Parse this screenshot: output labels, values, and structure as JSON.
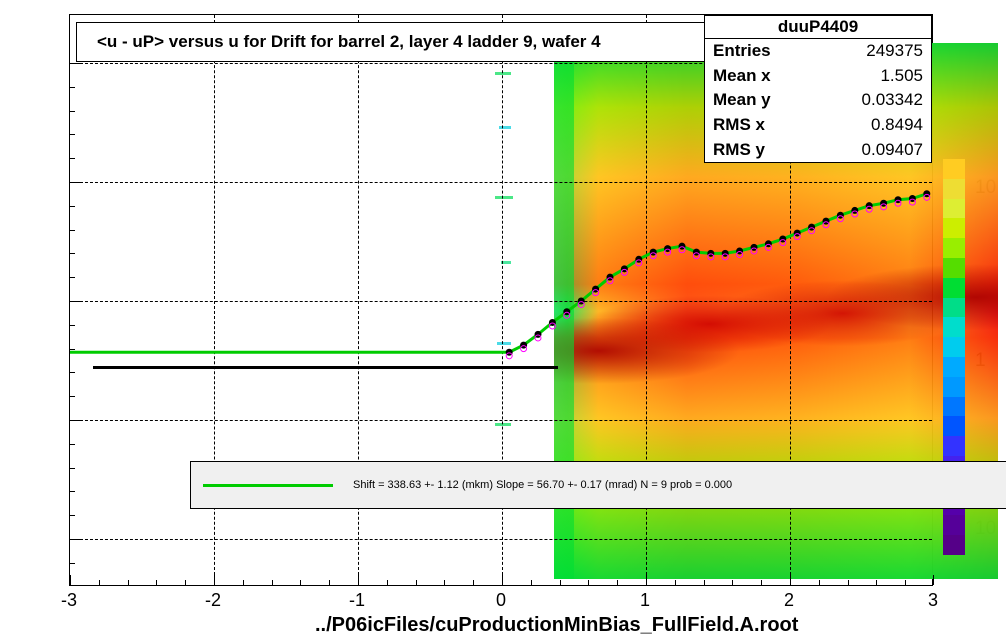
{
  "chart_data": {
    "type": "heatmap",
    "title": "<u - uP>       versus   u for Drift for barrel 2, layer 4 ladder 9, wafer 4",
    "histogram_name": "duuP4409",
    "x_range": [
      -3,
      3
    ],
    "y_range": [
      -0.24,
      0.24
    ],
    "x_ticks": [
      -3,
      -2,
      -1,
      0,
      1,
      2,
      3
    ],
    "y_ticks": [
      -0.2,
      -0.1,
      0,
      0.1,
      0.2
    ],
    "z_scale": "log",
    "z_labels": [
      "10",
      "1",
      "10"
    ],
    "x_caption": "../P06icFiles/cuProductionMinBias_FullField.A.root",
    "stats": {
      "Entries": "249375",
      "Mean x": "1.505",
      "Mean y": "0.03342",
      "RMS x": "0.8494",
      "RMS y": "0.09407"
    },
    "flat_line_y": -0.043,
    "profile_points": {
      "x": [
        0.05,
        0.15,
        0.25,
        0.35,
        0.45,
        0.55,
        0.65,
        0.75,
        0.85,
        0.95,
        1.05,
        1.15,
        1.25,
        1.35,
        1.45,
        1.55,
        1.65,
        1.75,
        1.85,
        1.95,
        2.05,
        2.15,
        2.25,
        2.35,
        2.45,
        2.55,
        2.65,
        2.75,
        2.85,
        2.95
      ],
      "y": [
        -0.043,
        -0.037,
        -0.028,
        -0.018,
        -0.009,
        0.0,
        0.01,
        0.02,
        0.027,
        0.035,
        0.041,
        0.044,
        0.046,
        0.041,
        0.04,
        0.04,
        0.042,
        0.045,
        0.048,
        0.052,
        0.057,
        0.062,
        0.067,
        0.072,
        0.076,
        0.08,
        0.082,
        0.085,
        0.086,
        0.09
      ]
    },
    "legend": {
      "shift": "338.63 +- 1.12 (mkm)",
      "slope": "56.70 +- 0.17 (mrad)",
      "N": 9,
      "prob": "0.000",
      "text": "Shift =   338.63 +- 1.12 (mkm) Slope =    56.70 +- 0.17 (mrad)  N = 9 prob = 0.000"
    },
    "color_palette": [
      "#5500aa",
      "#3333ff",
      "#0099ff",
      "#00ccee",
      "#00ddcc",
      "#00dd88",
      "#00dd33",
      "#55dd00",
      "#99ee00",
      "#ccee00",
      "#ddee33",
      "#eedd33",
      "#ffcc22",
      "#ffaa00",
      "#ff7700",
      "#ff4400",
      "#ff2200",
      "#ee0000",
      "#cc0000",
      "#aa0000"
    ]
  }
}
